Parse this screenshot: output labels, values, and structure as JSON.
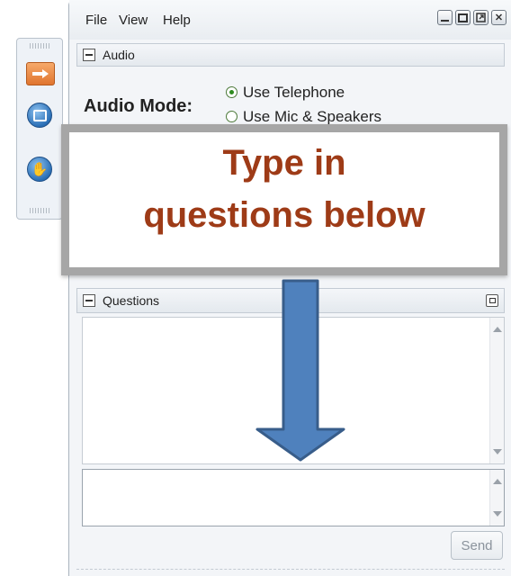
{
  "menu": {
    "file": "File",
    "view": "View",
    "help": "Help"
  },
  "audio": {
    "panel_title": "Audio",
    "mode_label": "Audio Mode:",
    "options": [
      "Use Telephone",
      "Use Mic & Speakers"
    ],
    "selected": "Use Telephone"
  },
  "questions": {
    "panel_title": "Questions",
    "log_text": "",
    "input_value": "",
    "send_label": "Send"
  },
  "annotation": {
    "line1": "Type in",
    "line2": "questions below",
    "text_color": "#9e3b17",
    "arrow_color": "#4f81bd"
  },
  "sidebar": {
    "buttons": [
      "arrow-right-icon",
      "screen-icon",
      "raise-hand-icon"
    ]
  },
  "window_buttons": [
    "minimize-icon",
    "maximize-icon",
    "restore-icon",
    "close-icon"
  ]
}
